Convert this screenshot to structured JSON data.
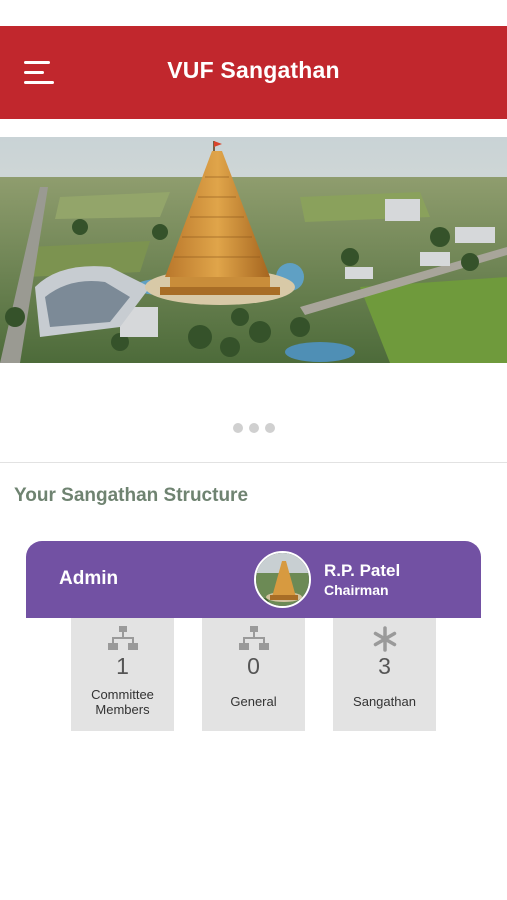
{
  "header": {
    "title": "VUF Sangathan",
    "menu_icon": "hamburger-menu-icon",
    "background": "#c1272d"
  },
  "carousel": {
    "image": "temple-aerial-render",
    "page_count": 3,
    "active_index": 0
  },
  "section": {
    "title": "Your Sangathan Structure"
  },
  "card": {
    "role": "Admin",
    "header_color": "#7251a3",
    "person": {
      "name": "R.P. Patel",
      "title": "Chairman"
    },
    "stats": [
      {
        "icon": "sitemap-icon",
        "value": "1",
        "label_lines": [
          "Committee",
          "Members"
        ]
      },
      {
        "icon": "sitemap-icon",
        "value": "0",
        "label_lines": [
          "General"
        ]
      },
      {
        "icon": "asterisk-icon",
        "value": "3",
        "label_lines": [
          "Sangathan"
        ]
      }
    ]
  }
}
